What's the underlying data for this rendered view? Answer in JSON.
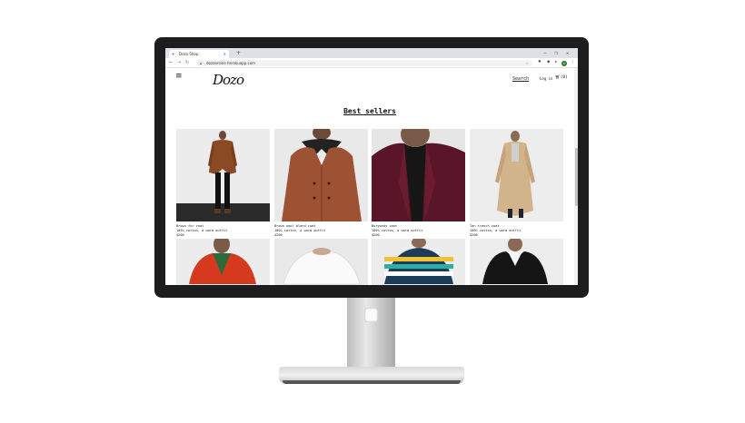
{
  "browser": {
    "tab_title": "Dozo Shop",
    "url": "dozoonline.herokuapp.com",
    "new_tab": "+",
    "user_initial": "D"
  },
  "site": {
    "logo": "Dozo",
    "search": "Search",
    "login": "Log in",
    "cart_count": "(0)"
  },
  "section": {
    "title": "Best sellers"
  },
  "products": [
    {
      "name": "Brown fur coat",
      "desc": "100% cotton, a warm outfit",
      "price": "$200"
    },
    {
      "name": "Brown wool blend coat",
      "desc": "100% cotton, a warm outfit",
      "price": "$200"
    },
    {
      "name": "Burgundy coat",
      "desc": "100% cotton, a warm outfit",
      "price": "$200"
    },
    {
      "name": "Tan trench coat",
      "desc": "100% cotton, a warm outfit",
      "price": "$200"
    }
  ],
  "colors": {
    "bezel": "#1d1d1f",
    "page_bg": "#ffffff"
  }
}
